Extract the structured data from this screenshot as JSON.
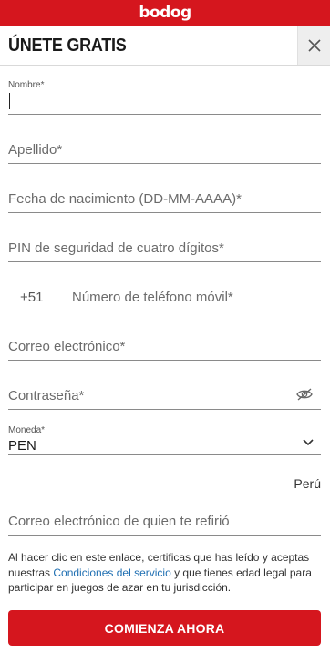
{
  "brand": {
    "logo_text": "bodog",
    "color": "#d5161e"
  },
  "header": {
    "title": "ÚNETE GRATIS",
    "close_icon": "close-icon"
  },
  "form": {
    "first_name": {
      "label": "Nombre*",
      "value": ""
    },
    "last_name": {
      "placeholder": "Apellido*"
    },
    "dob": {
      "placeholder": "Fecha de nacimiento (DD-MM-AAAA)*"
    },
    "pin": {
      "placeholder": "PIN de seguridad de cuatro dígitos*"
    },
    "phone": {
      "prefix": "+51",
      "placeholder": "Número de teléfono móvil*"
    },
    "email": {
      "placeholder": "Correo electrónico*"
    },
    "password": {
      "placeholder": "Contraseña*",
      "toggle_icon": "eye-off-icon"
    },
    "currency": {
      "label": "Moneda*",
      "value": "PEN",
      "icon": "chevron-down-icon"
    },
    "country": "Perú",
    "referrer": {
      "placeholder": "Correo electrónico de quien te refirió"
    }
  },
  "terms": {
    "before": "Al hacer clic en este enlace, certificas que has leído y aceptas nuestras ",
    "link": "Condiciones del servicio",
    "after": " y que tienes edad legal para participar en juegos de azar en tu jurisdicción."
  },
  "cta": {
    "label": "COMIENZA AHORA"
  }
}
